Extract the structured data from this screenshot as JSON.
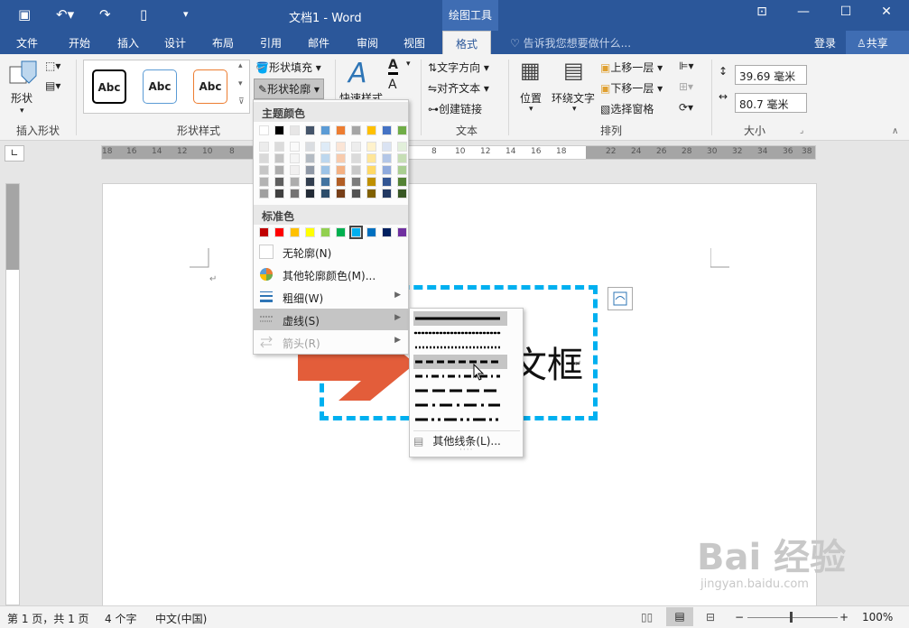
{
  "titlebar": {
    "title": "文档1 - Word",
    "context_tool": "绘图工具",
    "win_minimize": "—",
    "win_maximize": "☐",
    "win_close": "✕",
    "ribbon_display": "⊡"
  },
  "tabs": [
    {
      "label": "文件"
    },
    {
      "label": "开始"
    },
    {
      "label": "插入"
    },
    {
      "label": "设计"
    },
    {
      "label": "布局"
    },
    {
      "label": "引用"
    },
    {
      "label": "邮件"
    },
    {
      "label": "审阅"
    },
    {
      "label": "视图"
    },
    {
      "label": "格式"
    }
  ],
  "tell_me": "告诉我您想要做什么...",
  "login": "登录",
  "share": "共享",
  "ribbon": {
    "shape_btn": "形状",
    "insert_shape_group": "插入形状",
    "style_samples": [
      "Abc",
      "Abc",
      "Abc"
    ],
    "style_sample_colors": [
      "#000000",
      "#5b9bd5",
      "#ed7d31"
    ],
    "shape_style_group": "形状样式",
    "shape_fill": "形状填充",
    "shape_outline": "形状轮廓",
    "quick_style": "快速样式",
    "text_direction": "文字方向",
    "align_text": "对齐文本",
    "create_link": "创建链接",
    "text_group": "文本",
    "position": "位置",
    "wrap_text": "环绕文字",
    "bring_forward": "上移一层",
    "send_backward": "下移一层",
    "selection_pane": "选择窗格",
    "arrange_group": "排列",
    "height": "39.69 毫米",
    "width": "80.7 毫米",
    "size_group": "大小"
  },
  "ruler_ticks": [
    "18",
    "16",
    "14",
    "12",
    "10",
    "8",
    "8",
    "10",
    "12",
    "14",
    "16",
    "18",
    "22",
    "24",
    "26",
    "28",
    "30",
    "32",
    "34",
    "36",
    "38"
  ],
  "document": {
    "shape_text": "文框",
    "return_mark": "↵",
    "outline_color": "#00b0f0"
  },
  "outline_menu": {
    "theme_colors_title": "主题颜色",
    "theme_top": [
      "#ffffff",
      "#000000",
      "#e7e6e6",
      "#44546a",
      "#5b9bd5",
      "#ed7d31",
      "#a5a5a5",
      "#ffc000",
      "#4472c4",
      "#70ad47"
    ],
    "standard_colors_title": "标准色",
    "standard": [
      "#c00000",
      "#ff0000",
      "#ffc000",
      "#ffff00",
      "#92d050",
      "#00b050",
      "#00b0f0",
      "#0070c0",
      "#002060",
      "#7030a0"
    ],
    "no_outline": "无轮廓(N)",
    "more_colors": "其他轮廓颜色(M)...",
    "weight": "粗细(W)",
    "dashes": "虚线(S)",
    "arrows": "箭头(R)"
  },
  "dash_menu": {
    "styles": [
      "solid",
      "round-dot",
      "square-dot",
      "dash",
      "dash-dot",
      "long-dash",
      "long-dash-dot",
      "long-dash-dot-dot"
    ],
    "more_lines": "其他线条(L)..."
  },
  "statusbar": {
    "page": "第 1 页，共 1 页",
    "words": "4 个字",
    "language": "中文(中国)",
    "zoom": "100%"
  },
  "watermark": {
    "brand": "Bai 经验",
    "url": "jingyan.baidu.com"
  }
}
